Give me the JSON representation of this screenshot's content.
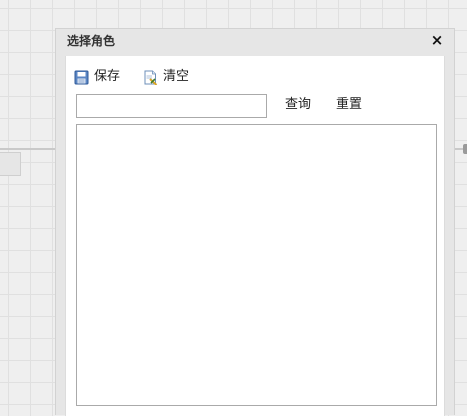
{
  "dialog": {
    "title": "选择角色",
    "close_label": "×"
  },
  "toolbar": {
    "save_label": "保存",
    "clear_label": "清空"
  },
  "search": {
    "value": "",
    "query_label": "查询",
    "reset_label": "重置"
  },
  "list": {
    "items": []
  },
  "icons": {
    "save": "save-disk-icon",
    "clear": "clear-document-icon",
    "close": "close-icon"
  }
}
